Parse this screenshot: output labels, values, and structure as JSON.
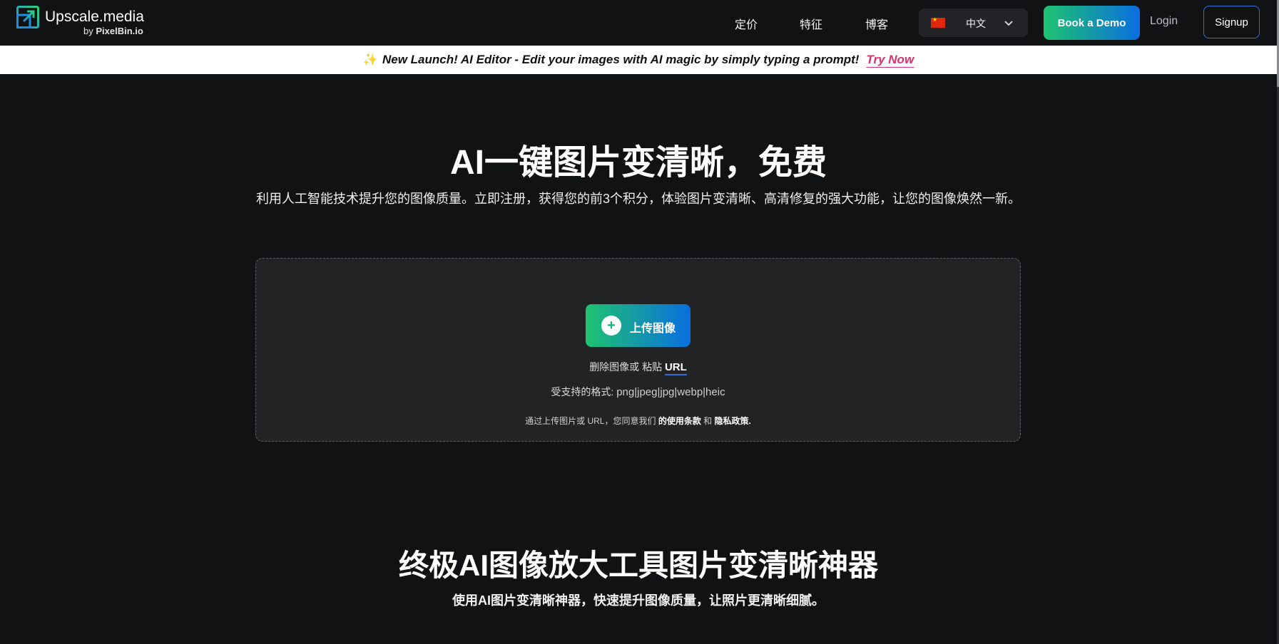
{
  "header": {
    "logo_name": "Upscale.media",
    "logo_by": "by",
    "logo_by_brand": "PixelBin.io",
    "nav": {
      "pricing": "定价",
      "features": "特征",
      "blog": "博客"
    },
    "language": "中文",
    "book_demo": "Book a Demo",
    "login": "Login",
    "signup": "Signup"
  },
  "banner": {
    "text": "New Launch! AI Editor - Edit your images with AI magic by simply typing a prompt!",
    "cta": "Try Now"
  },
  "hero": {
    "title": "AI一键图片变清晰，免费",
    "subtitle": "利用人工智能技术提升您的图像质量。立即注册，获得您的前3个积分，体验图片变清晰、高清修复的强大功能，让您的图像焕然一新。"
  },
  "upload": {
    "button": "上传图像",
    "drop_text": "删除图像或 粘贴",
    "url_link": "URL",
    "formats_label": "受支持的格式:",
    "formats": "png|jpeg|jpg|webp|heic",
    "terms_prefix": "通过上传图片或 URL，您同意我们",
    "terms_link": "的使用条款",
    "terms_and": "和",
    "privacy_link": "隐私政策."
  },
  "section2": {
    "title": "终极AI图像放大工具图片变清晰神器",
    "subtitle": "使用AI图片变清晰神器，快速提升图像质量，让照片更清晰细腻。"
  },
  "colors": {
    "background": "#111214",
    "accent_green": "#1ec36f",
    "accent_blue": "#0a6ee0",
    "link_pink": "#d6336c"
  },
  "icons": {
    "logo": "upscale-arrow-icon",
    "flag": "china-flag-icon",
    "chevron": "chevron-down-icon",
    "plus": "plus-circle-icon",
    "sparkle": "sparkle-icon"
  }
}
